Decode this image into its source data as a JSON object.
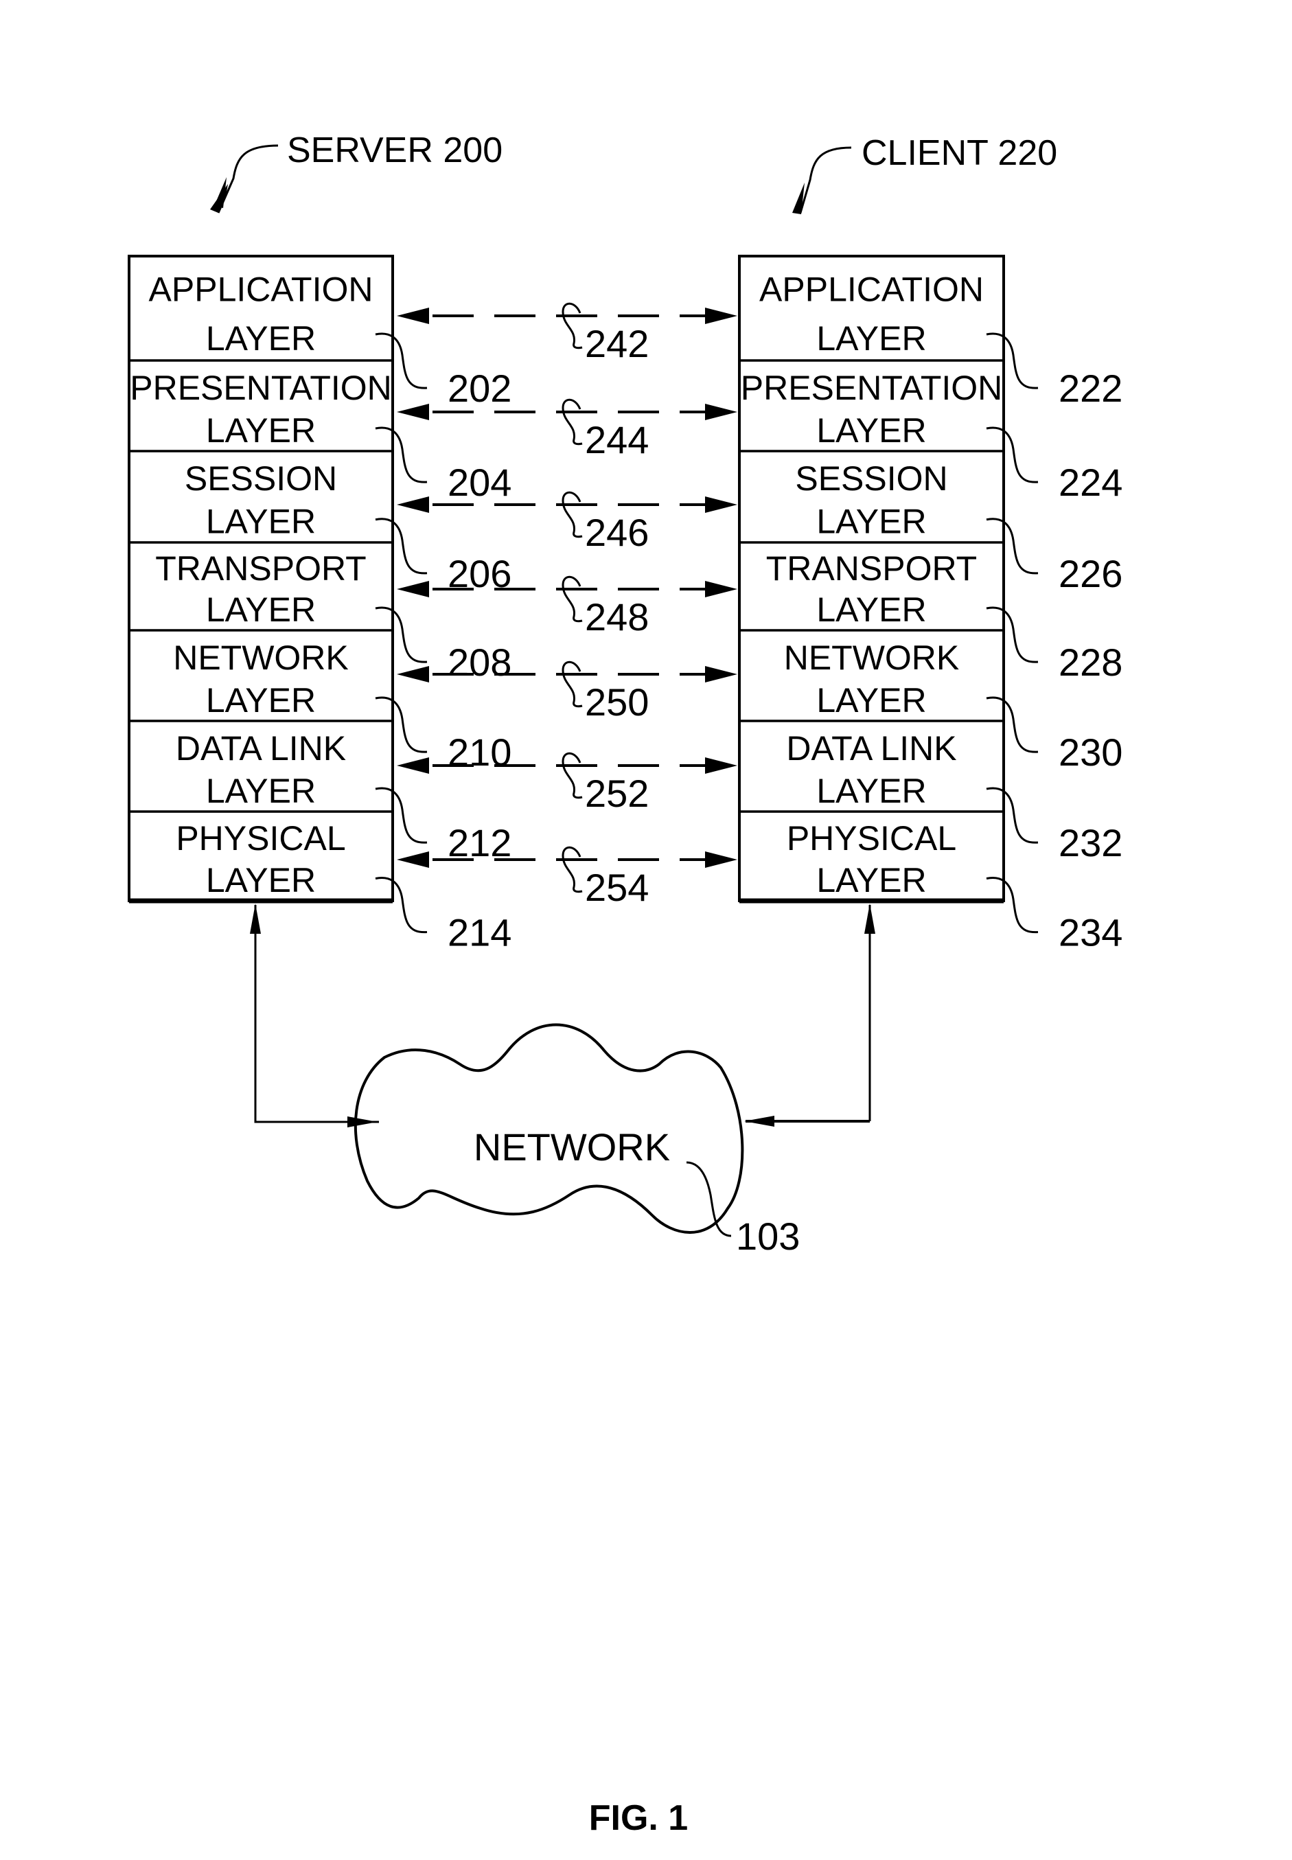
{
  "figure": {
    "caption": "FIG. 1"
  },
  "server": {
    "title": "SERVER 200",
    "layers": [
      {
        "line1": "APPLICATION",
        "line2": "LAYER",
        "ref": "202"
      },
      {
        "line1": "PRESENTATION",
        "line2": "LAYER",
        "ref": "204"
      },
      {
        "line1": "SESSION",
        "line2": "LAYER",
        "ref": "206"
      },
      {
        "line1": "TRANSPORT",
        "line2": "LAYER",
        "ref": "208"
      },
      {
        "line1": "NETWORK",
        "line2": "LAYER",
        "ref": "210"
      },
      {
        "line1": "DATA LINK",
        "line2": "LAYER",
        "ref": "212"
      },
      {
        "line1": "PHYSICAL",
        "line2": "LAYER",
        "ref": "214"
      }
    ]
  },
  "client": {
    "title": "CLIENT 220",
    "layers": [
      {
        "line1": "APPLICATION",
        "line2": "LAYER",
        "ref": "222"
      },
      {
        "line1": "PRESENTATION",
        "line2": "LAYER",
        "ref": "224"
      },
      {
        "line1": "SESSION",
        "line2": "LAYER",
        "ref": "226"
      },
      {
        "line1": "TRANSPORT",
        "line2": "LAYER",
        "ref": "228"
      },
      {
        "line1": "NETWORK",
        "line2": "LAYER",
        "ref": "230"
      },
      {
        "line1": "DATA LINK",
        "line2": "LAYER",
        "ref": "232"
      },
      {
        "line1": "PHYSICAL",
        "line2": "LAYER",
        "ref": "234"
      }
    ]
  },
  "peer_links": [
    {
      "ref": "242"
    },
    {
      "ref": "244"
    },
    {
      "ref": "246"
    },
    {
      "ref": "248"
    },
    {
      "ref": "250"
    },
    {
      "ref": "252"
    },
    {
      "ref": "254"
    }
  ],
  "network": {
    "label": "NETWORK",
    "ref": "103"
  }
}
